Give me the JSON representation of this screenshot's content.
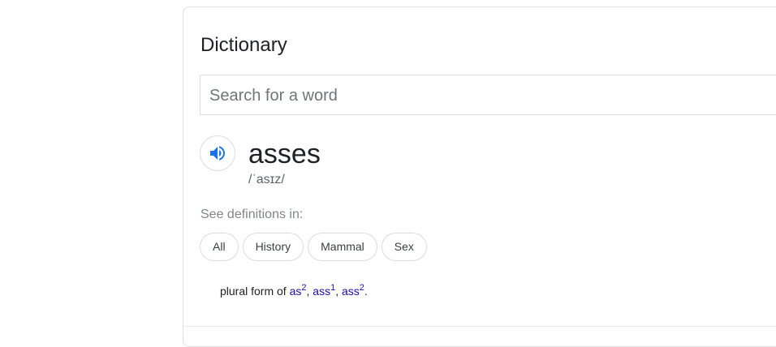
{
  "dictionary": {
    "title": "Dictionary",
    "search": {
      "placeholder": "Search for a word",
      "value": ""
    },
    "entry": {
      "word": "asses",
      "phonetic": "/ˈasɪz/",
      "pronounce_icon": "speaker-icon"
    },
    "see_definitions_label": "See definitions in:",
    "chips": [
      "All",
      "History",
      "Mammal",
      "Sex"
    ],
    "definition": {
      "prefix": "plural form of ",
      "links": [
        {
          "text": "as",
          "superscript": "2"
        },
        {
          "text": "ass",
          "superscript": "1"
        },
        {
          "text": "ass",
          "superscript": "2"
        }
      ],
      "separator": ", ",
      "suffix": "."
    }
  },
  "colors": {
    "link": "#1a0dab",
    "speaker_icon": "#1a73e8",
    "border": "#dadce0",
    "muted_text": "#80868b"
  }
}
